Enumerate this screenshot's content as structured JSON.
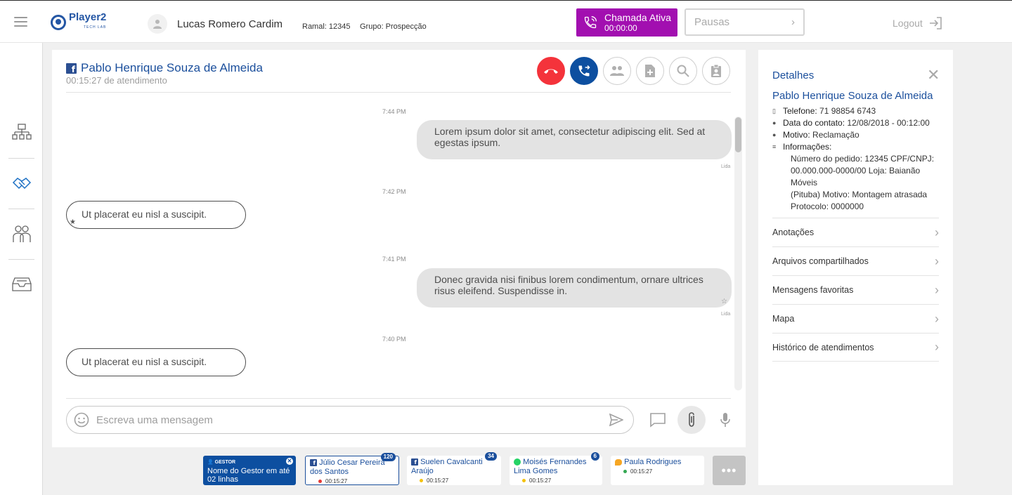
{
  "header": {
    "logo_text": "Player2",
    "logo_sub": "TECH LAB",
    "agent_name": "Lucas Romero Cardim",
    "ramal": "Ramal: 12345",
    "grupo": "Grupo: Prospecção",
    "call_label": "Chamada Ativa",
    "call_time": "00:00:00",
    "pausas_label": "Pausas",
    "logout_label": "Logout"
  },
  "sidebar": {
    "items": [
      {
        "icon": "org-chart-icon"
      },
      {
        "icon": "handshake-icon"
      },
      {
        "icon": "team-icon"
      },
      {
        "icon": "inbox-icon"
      }
    ]
  },
  "chat": {
    "contact_name": "Pablo Henrique Souza de Almeida",
    "timer": "00:15:27 de atendimento",
    "messages": [
      {
        "time": "7:44 PM",
        "direction": "out",
        "text_l1": "Lorem ipsum dolor sit amet, consectetur adipiscing elit. Sed at",
        "text_l2": "egestas ipsum.",
        "status": "Lida"
      },
      {
        "time": "7:42 PM",
        "direction": "in",
        "text": "Ut placerat eu nisl a suscipit.",
        "starred": true
      },
      {
        "time": "7:41 PM",
        "direction": "out",
        "text_l1": "Donec gravida nisi finibus lorem condimentum, ornare ultrices",
        "text_l2": "risus eleifend. Suspendisse in.",
        "status": "Lida",
        "starred": true
      },
      {
        "time": "7:40 PM",
        "direction": "in",
        "text": "Ut placerat eu nisl a suscipit."
      }
    ],
    "composer_placeholder": "Escreva uma mensagem"
  },
  "details": {
    "title": "Detalhes",
    "name": "Pablo Henrique Souza de Almeida",
    "telefone_label": "Telefone:",
    "telefone": "71 98854 6743",
    "data_label": "Data do contato:",
    "data": "12/08/2018 - 00:12:00",
    "motivo_label": "Motivo:",
    "motivo": "Reclamação",
    "info_label": "Informações:",
    "info_l1": "Número do pedido: 12345 CPF/CNPJ:",
    "info_l2": "00.000.000-0000/00 Loja: Baianão Móveis",
    "info_l3": "(Pituba) Motivo: Montagem atrasada",
    "info_l4": "Protocolo: 0000000",
    "menu": [
      "Anotações",
      "Arquivos compartilhados",
      "Mensagens favoritas",
      "Mapa",
      "Histórico de atendimentos"
    ]
  },
  "bottom": {
    "gestor_label": "GESTOR",
    "gestor_text": "Nome do Gestor em até 02 linhas",
    "cards": [
      {
        "name": "Júlio Cesar Pereira dos Santos",
        "time": "00:15:27",
        "badge": "120",
        "channel": "facebook",
        "dot": "#e53935"
      },
      {
        "name": "Suelen Cavalcanti Araújo",
        "time": "00:15:27",
        "badge": "34",
        "channel": "facebook",
        "dot": "#f4c20d"
      },
      {
        "name": "Moisés Fernandes Lima Gomes",
        "time": "00:15:27",
        "badge": "6",
        "channel": "whatsapp",
        "dot": "#f4c20d"
      },
      {
        "name": "Paula Rodrigues",
        "time": "00:15:27",
        "channel": "chat",
        "dot": "#34a853"
      }
    ],
    "more_label": "•••"
  },
  "colors": {
    "brand_blue": "#1b4f9c",
    "call_purple": "#a20fb0",
    "hangup_red": "#f4333b"
  }
}
